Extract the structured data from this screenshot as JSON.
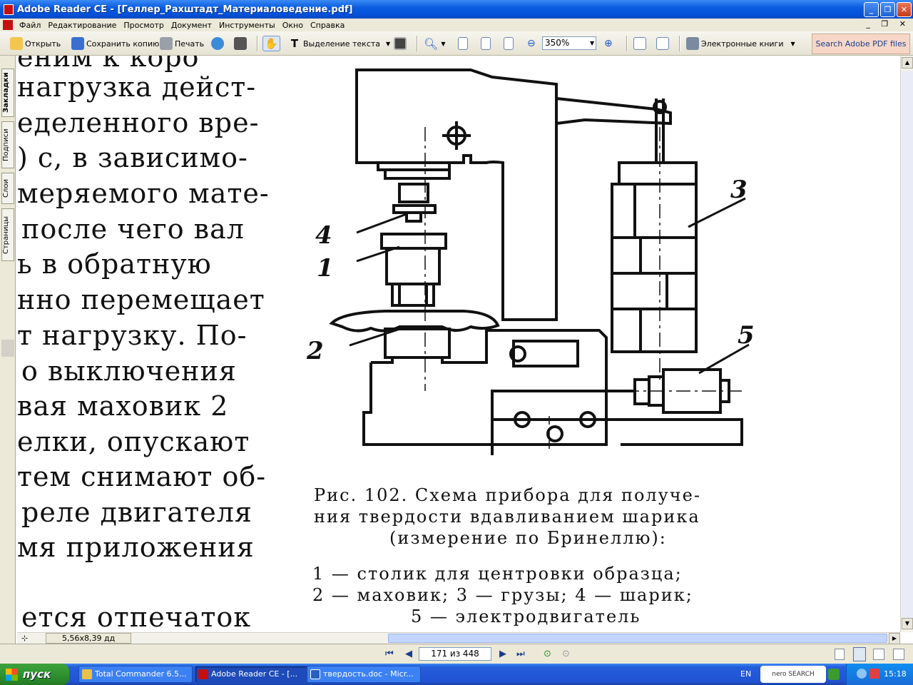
{
  "window": {
    "title": "Adobe Reader CE - [Геллер_Рахштадт_Материаловедение.pdf]",
    "controls": [
      "_",
      "❐",
      "✕"
    ],
    "doc_controls": "_ ❐ ✕"
  },
  "menu": [
    "Файл",
    "Редактирование",
    "Просмотр",
    "Документ",
    "Инструменты",
    "Окно",
    "Справка"
  ],
  "toolbar": {
    "open": "Открыть",
    "save_copy": "Сохранить копию",
    "print": "Печать",
    "select_text": "Выделение текста",
    "zoom": "350%",
    "ebooks": "Электронные книги",
    "search": "Search Adobe PDF files"
  },
  "nav_tabs": [
    "Закладки",
    "Подписи",
    "Слои",
    "Страницы"
  ],
  "page": {
    "text_lines": [
      "еним к коро",
      "нагрузка дейст-",
      "еделенного вре-",
      ") с, в зависимо-",
      "меряемого мате-",
      "после чего вал",
      "ь в обратную",
      "нно перемещает",
      "т нагрузку. По-",
      "о выключения",
      "вая маховик 2",
      "елки, опускают",
      "тем снимают об-",
      "реле двигателя",
      "мя приложения",
      "ется отпечаток"
    ],
    "figure_labels": [
      "4",
      "1",
      "2",
      "3",
      "5"
    ],
    "caption": [
      "Рис. 102. Схема прибора для получе-",
      "ния твердости вдавливанием шарика",
      "(измерение по Бринеллю):"
    ],
    "legend": [
      "1 — столик для центровки образца;",
      "2 — маховик; 3 — грузы; 4 — шарик;",
      "5 — электродвигатель"
    ]
  },
  "page_size": "5,56x8,39 дд",
  "status": {
    "page_field": "171 из 448"
  },
  "taskbar": {
    "start": "пуск",
    "tasks": [
      "Total Commander 6.5...",
      "Adobe Reader CE - [...",
      "твердость.doc - Micr..."
    ],
    "lang": "EN",
    "nero": "nero SEARCH",
    "clock": "15:18"
  }
}
